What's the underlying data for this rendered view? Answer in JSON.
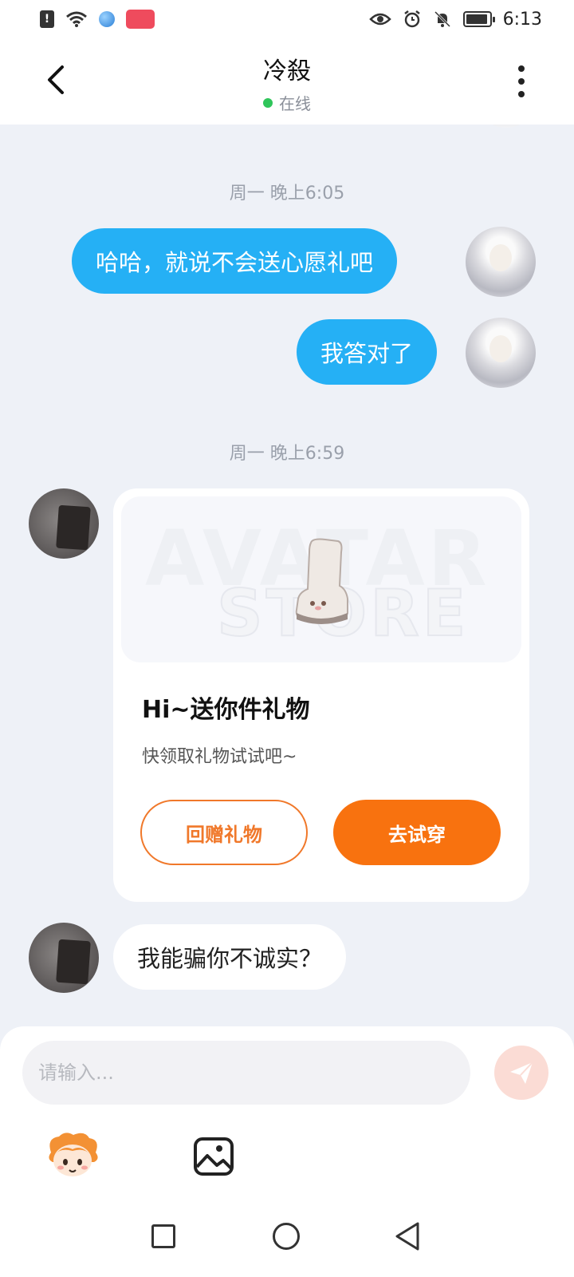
{
  "status_bar": {
    "time": "6:13"
  },
  "header": {
    "title": "冷殺",
    "status": "在线",
    "back_icon": "chevron-left-icon",
    "more_icon": "more-vertical-icon"
  },
  "messages": [
    {
      "type": "timestamp",
      "text": "周一 晚上6:05"
    },
    {
      "type": "out",
      "text": "哈哈，就说不会送心愿礼吧"
    },
    {
      "type": "out",
      "text": "我答对了"
    },
    {
      "type": "timestamp",
      "text": "周一 晚上6:59"
    },
    {
      "type": "gift_card",
      "heading": "Hi~送你件礼物",
      "subtext": "快领取礼物试试吧~",
      "return_gift_label": "回赠礼物",
      "try_on_label": "去试穿"
    },
    {
      "type": "in",
      "text": "我能骗你不诚实？"
    }
  ],
  "composer": {
    "placeholder": "请输入...",
    "send_icon": "send-icon",
    "mascot_icon": "mascot-sticker-icon",
    "image_icon": "image-icon"
  },
  "colors": {
    "outgoing_bubble": "#25b0f5",
    "accent_orange": "#f8720f",
    "online_green": "#2fc55a"
  }
}
